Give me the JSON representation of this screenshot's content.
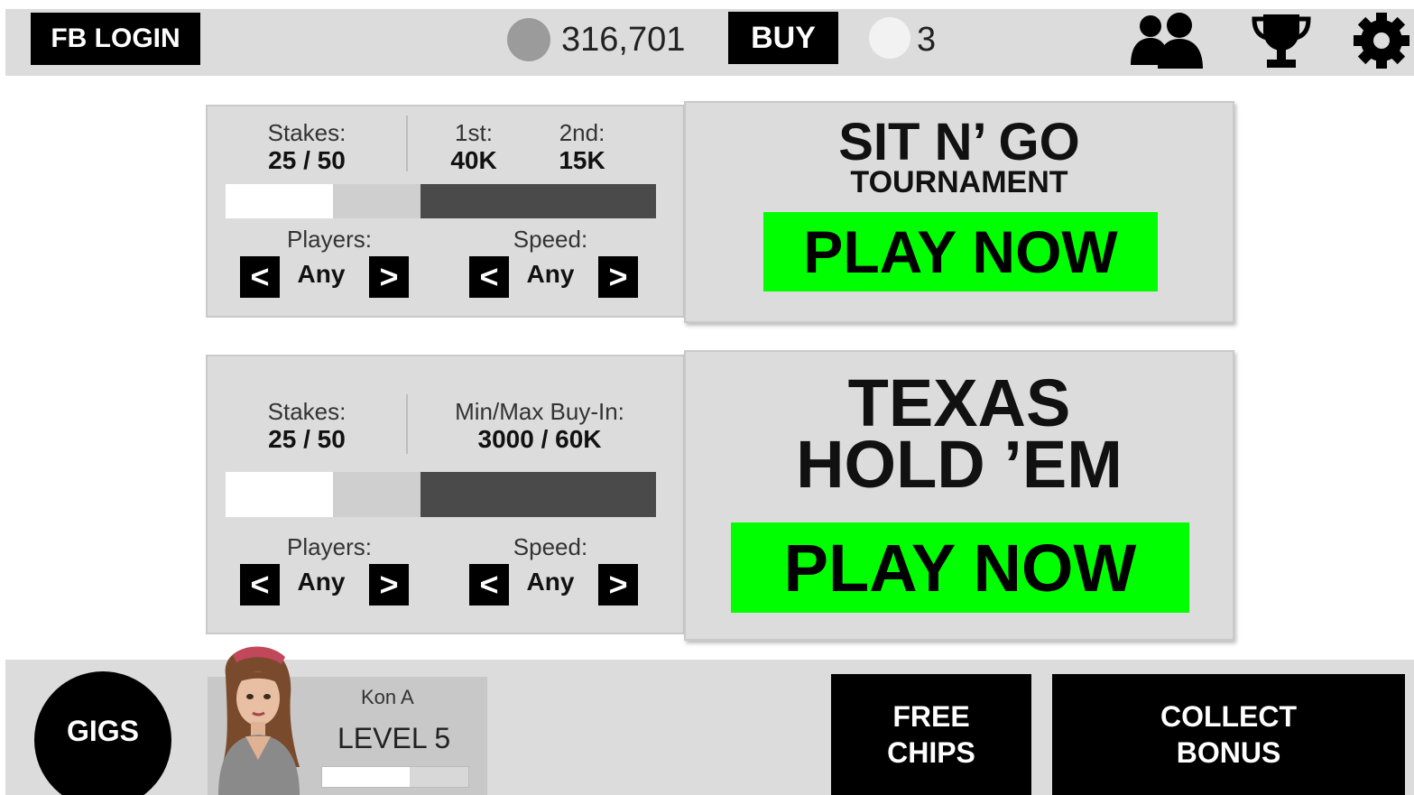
{
  "topbar": {
    "fb_login": "FB LOGIN",
    "chip_count": "316,701",
    "buy": "BUY",
    "gem_count": "3",
    "icons": [
      "friends-icon",
      "trophy-icon",
      "gear-icon"
    ]
  },
  "sitngo": {
    "stakes_label": "Stakes:",
    "stakes_value": "25 / 50",
    "first_label": "1st:",
    "first_value": "40K",
    "second_label": "2nd:",
    "second_value": "15K",
    "slider_level_pct": 25,
    "players_label": "Players:",
    "players_value": "Any",
    "speed_label": "Speed:",
    "speed_value": "Any",
    "prev": "<",
    "next": ">",
    "title": "SIT N’ GO",
    "subtitle": "TOURNAMENT",
    "play": "PLAY NOW"
  },
  "holdem": {
    "stakes_label": "Stakes:",
    "stakes_value": "25 / 50",
    "buyin_label": "Min/Max Buy-In:",
    "buyin_value": "3000 / 60K",
    "slider_level_pct": 25,
    "players_label": "Players:",
    "players_value": "Any",
    "speed_label": "Speed:",
    "speed_value": "Any",
    "prev": "<",
    "next": ">",
    "title_line1": "TEXAS",
    "title_line2": "HOLD ’EM",
    "play": "PLAY NOW"
  },
  "bottombar": {
    "gigs": "GIGS",
    "player_name": "Kon A",
    "level": "LEVEL 5",
    "xp_pct": 60,
    "free_chips_line1": "FREE",
    "free_chips_line2": "CHIPS",
    "collect_line1": "COLLECT",
    "collect_line2": "BONUS"
  },
  "colors": {
    "play_green": "#00ff00",
    "panel_grey": "#dcdcdc",
    "button_black": "#000000"
  }
}
